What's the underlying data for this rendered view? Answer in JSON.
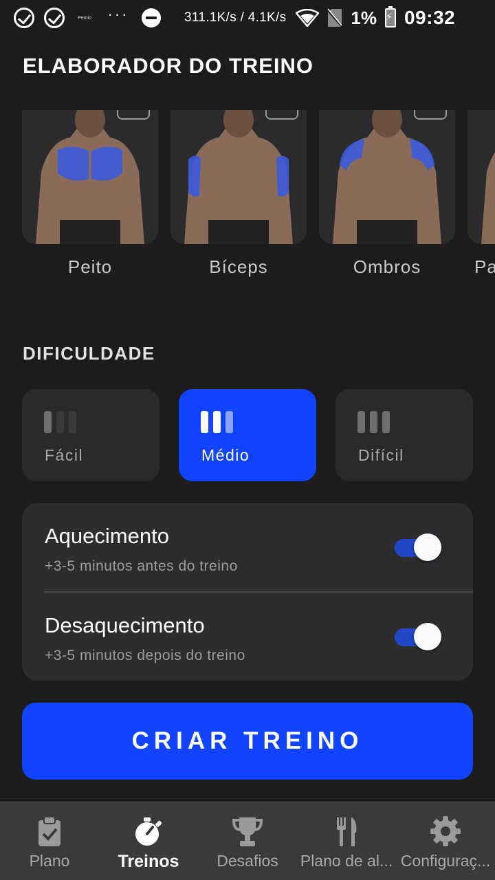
{
  "status_bar": {
    "tiny_label": "Pemio",
    "dots": "···",
    "network_speed": "311.1K/s / 4.1K/s",
    "battery_percent": "1%",
    "time": "09:32"
  },
  "page_title": "ELABORADOR DO TREINO",
  "muscles": [
    {
      "label": "Peito"
    },
    {
      "label": "Bíceps"
    },
    {
      "label": "Ombros"
    },
    {
      "label": "Pa"
    }
  ],
  "difficulty": {
    "title": "DIFICULDADE",
    "options": [
      {
        "label": "Fácil",
        "level": 1,
        "selected": false
      },
      {
        "label": "Médio",
        "level": 2,
        "selected": true
      },
      {
        "label": "Difícil",
        "level": 3,
        "selected": false
      }
    ]
  },
  "settings": [
    {
      "title": "Aquecimento",
      "subtitle": "+3-5 minutos antes do treino",
      "enabled": true
    },
    {
      "title": "Desaquecimento",
      "subtitle": "+3-5 minutos depois do treino",
      "enabled": true
    }
  ],
  "cta_label": "CRIAR TREINO",
  "bottom_nav": [
    {
      "label": "Plano",
      "icon": "clipboard-check-icon",
      "active": false
    },
    {
      "label": "Treinos",
      "icon": "stopwatch-icon",
      "active": true
    },
    {
      "label": "Desafios",
      "icon": "trophy-icon",
      "active": false
    },
    {
      "label": "Plano de al...",
      "icon": "fork-knife-icon",
      "active": false
    },
    {
      "label": "Configuraç...",
      "icon": "gear-icon",
      "active": false
    }
  ],
  "colors": {
    "accent": "#1144ff",
    "background": "#1c1c1e",
    "card": "#2a2a2c",
    "highlight_muscle": "#3b5bdb"
  }
}
